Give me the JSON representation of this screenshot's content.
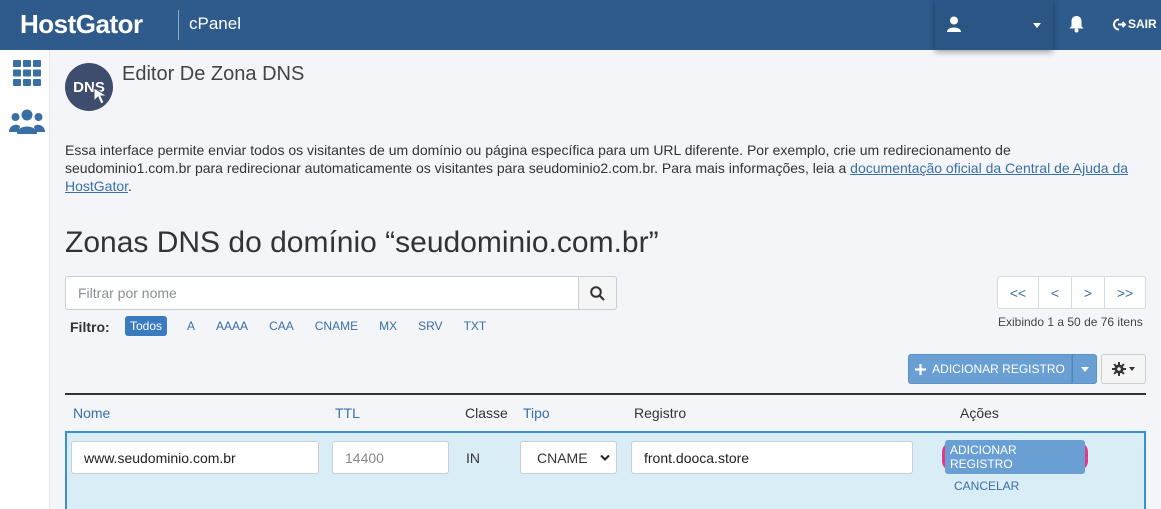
{
  "header": {
    "brand": "HostGator",
    "product": "cPanel",
    "logout_label": "SAIR"
  },
  "page": {
    "title": "Editor De Zona DNS",
    "logo_text": "DNS",
    "description_pre": "Essa interface permite enviar todos os visitantes de um domínio ou página específica para um URL diferente. Por exemplo, crie um redirecionamento de seudominio1.com.br para redirecionar automaticamente os visitantes para seudominio2.com.br. Para mais informações, leia a ",
    "description_link": "documentação oficial da Central de Ajuda da HostGator",
    "description_post": ".",
    "zone_heading": "Zonas DNS do domínio “seudominio.com.br”"
  },
  "search": {
    "placeholder": "Filtrar por nome"
  },
  "filters": {
    "label": "Filtro:",
    "items": [
      "Todos",
      "A",
      "AAAA",
      "CAA",
      "CNAME",
      "MX",
      "SRV",
      "TXT"
    ],
    "active": "Todos"
  },
  "pagination": {
    "first": "<<",
    "prev": "<",
    "next": ">",
    "last": ">>",
    "showing": "Exibindo 1 a 50 de 76 itens"
  },
  "toolbar": {
    "add_label": "ADICIONAR REGISTRO"
  },
  "table": {
    "headers": [
      "Nome",
      "TTL",
      "Classe",
      "Tipo",
      "Registro",
      "Ações"
    ]
  },
  "edit_row": {
    "name_value": "www.seudominio.com.br",
    "ttl_placeholder": "14400",
    "class": "IN",
    "type_selected": "CNAME",
    "record_value": "front.dooca.store",
    "save_label": "ADICIONAR REGISTRO",
    "cancel_label": "CANCELAR"
  },
  "colors": {
    "header_bg": "#2e5a8c",
    "accent": "#3a7bbf",
    "highlight": "#e6388a",
    "row_bg": "#d9edf7"
  }
}
